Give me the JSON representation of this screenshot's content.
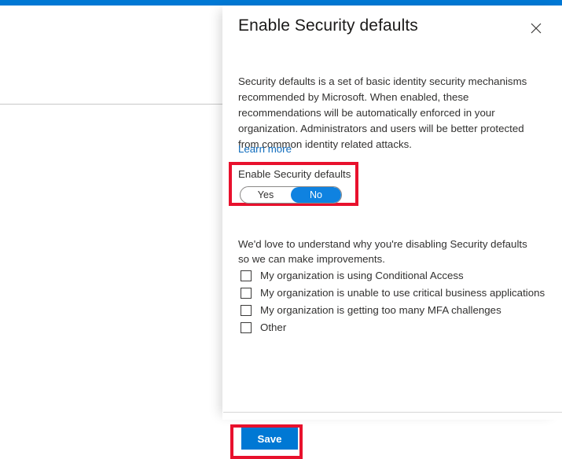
{
  "theme": {
    "accent_blue": "#0078d4",
    "toggle_on_blue": "#0f82e0",
    "link_blue": "#0f6cbd",
    "highlight_red": "#e8112d",
    "text_primary": "#323130",
    "title_color": "#1b1a19"
  },
  "blade": {
    "title": "Enable Security defaults",
    "close_icon": "close-icon",
    "description": "Security defaults is a set of basic identity security mechanisms recommended by Microsoft. When enabled, these recommendations will be automatically enforced in your organization. Administrators and users will be better protected from common identity related attacks.",
    "learn_more_label": "Learn more"
  },
  "toggle": {
    "label": "Enable Security defaults",
    "options": [
      {
        "value": "yes",
        "label": "Yes",
        "selected": false
      },
      {
        "value": "no",
        "label": "No",
        "selected": true
      }
    ],
    "selected_value": "No"
  },
  "feedback": {
    "prompt": "We'd love to understand why you're disabling Security defaults so we can make improvements.",
    "options": [
      {
        "label": "My organization is using Conditional Access",
        "checked": false
      },
      {
        "label": "My organization is unable to use critical business applications",
        "checked": false
      },
      {
        "label": "My organization is getting too many MFA challenges",
        "checked": false
      },
      {
        "label": "Other",
        "checked": false
      }
    ]
  },
  "footer": {
    "save_label": "Save"
  }
}
